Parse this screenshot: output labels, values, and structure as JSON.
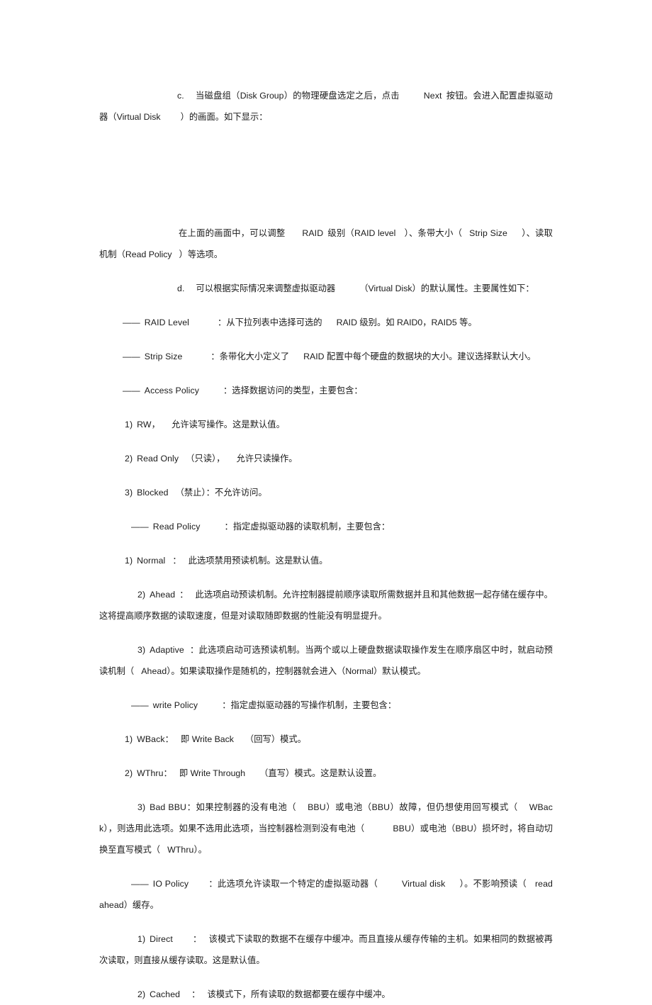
{
  "document": {
    "language": "zh-CN",
    "kind": "technical-manual-page",
    "topic": "RAID Virtual Disk configuration properties",
    "background_color": "#ffffff",
    "text_color": "#1a1a1a"
  },
  "blocks": {
    "step_c": {
      "marker": "c.",
      "text_part1": "当磁盘组（Disk Group）的物理硬盘选定之后，点击",
      "text_next": "Next",
      "text_part2": "按钮。会进入配置虚拟驱动器（Virtual Disk",
      "text_part3": "）的画面。如下显示："
    },
    "image_caption_para": {
      "text_part1": "在上面的画面中，可以调整",
      "term_raid": "RAID",
      "text_part2": "级别（RAID level",
      "text_part3": "）、条带大小（",
      "term_strip": "Strip Size",
      "text_part4": "）、读取机制（Read Policy",
      "text_part5": "）等选项。"
    },
    "step_d": {
      "marker": "d.",
      "text_part1": "可以根据实际情况来调整虚拟驱动器",
      "text_part2": "（Virtual  Disk）的默认属性。主要属性如下："
    },
    "raid_level": {
      "dash": "——",
      "term": "RAID Level",
      "colon": "：",
      "text_part1": "从下拉列表中选择可选的",
      "text_part2": "RAID 级别。如 RAID0，RAID5 等。"
    },
    "strip_size": {
      "dash": "——",
      "term": "Strip Size",
      "colon": "：",
      "text_part1": "条带化大小定义了",
      "text_part2": "RAID 配置中每个硬盘的数据块的大小。建议选择默认大小。"
    },
    "access_policy": {
      "dash": "——",
      "term": "Access Policy",
      "colon": "：",
      "text": "选择数据访问的类型，主要包含："
    },
    "access_items": [
      {
        "num": "1)",
        "term": "RW，",
        "text": "允许读写操作。这是默认值。"
      },
      {
        "num": "2)",
        "term": "Read Only",
        "text_part1": "（只读），",
        "text_part2": "允许只读操作。"
      },
      {
        "num": "3)",
        "term": "Blocked",
        "text": "（禁止）：不允许访问。"
      }
    ],
    "read_policy": {
      "dash": "——",
      "term": "Read Policy",
      "colon": "：",
      "text": "指定虚拟驱动器的读取机制，主要包含："
    },
    "read_items": [
      {
        "num": "1)",
        "term": "Normal",
        "colon": "：",
        "text": "此选项禁用预读机制。这是默认值。"
      },
      {
        "num": "2)",
        "term": "Ahead",
        "colon": "：",
        "text": "此选项启动预读机制。允许控制器提前顺序读取所需数据并且和其他数据一起存储在缓存中。这将提高顺序数据的读取速度，但是对读取随即数据的性能没有明显提升。"
      },
      {
        "num": "3)",
        "term": "Adaptive",
        "colon": "：",
        "text_part1": "此选项启动可选预读机制。当两个或以上硬盘数据读取操作发生在顺序扇区中时，就启动预读机制（",
        "text_term": "Ahead",
        "text_part2": "）。如果读取操作是随机的，控制器就会进入（Normal）默认模式。"
      }
    ],
    "write_policy": {
      "dash": "——",
      "term": "write Policy",
      "colon": "：",
      "text": "指定虚拟驱动器的写操作机制，主要包含："
    },
    "write_items": [
      {
        "num": "1)",
        "term": "WBack：",
        "text_part1": "即 Write Back",
        "text_part2": "（回写）模式。"
      },
      {
        "num": "2)",
        "term": "WThru：",
        "text_part1": "即 Write Through",
        "text_part2": "（直写）模式。这是默认设置。"
      },
      {
        "num": "3)",
        "term": "Bad BBU",
        "colon": "：",
        "text_part1": "如果控制器的没有电池（",
        "text_bbu1": "BBU",
        "text_part2": "）或电池（BBU）故障，但仍想使用回写模式（",
        "text_wback": "WBack",
        "text_part3": "），则选用此选项。如果不选用此选项，当控制器检测到没有电池（",
        "text_bbu2": "BBU",
        "text_part4": "）或电池（BBU）损坏时，将自动切换至直写模式（",
        "text_wthru": "WThru",
        "text_part5": "）。"
      }
    ],
    "io_policy": {
      "dash": "——",
      "term": "IO Policy",
      "colon": "：",
      "text_part1": "此选项允许读取一个特定的虚拟驱动器（",
      "term_vd": "Virtual disk",
      "text_part2": "）。不影响预读（",
      "term_ra": "read ahead",
      "text_part3": "）缓存。"
    },
    "io_items": [
      {
        "num": "1)",
        "term": "Direct",
        "colon": "：",
        "text": "该模式下读取的数据不在缓存中缓冲。而且直接从缓存传输的主机。如果相同的数据被再次读取，则直接从缓存读取。这是默认值。"
      },
      {
        "num": "2)",
        "term": "Cached",
        "colon": "：",
        "text": "该模式下，所有读取的数据都要在缓存中缓冲。"
      }
    ]
  }
}
